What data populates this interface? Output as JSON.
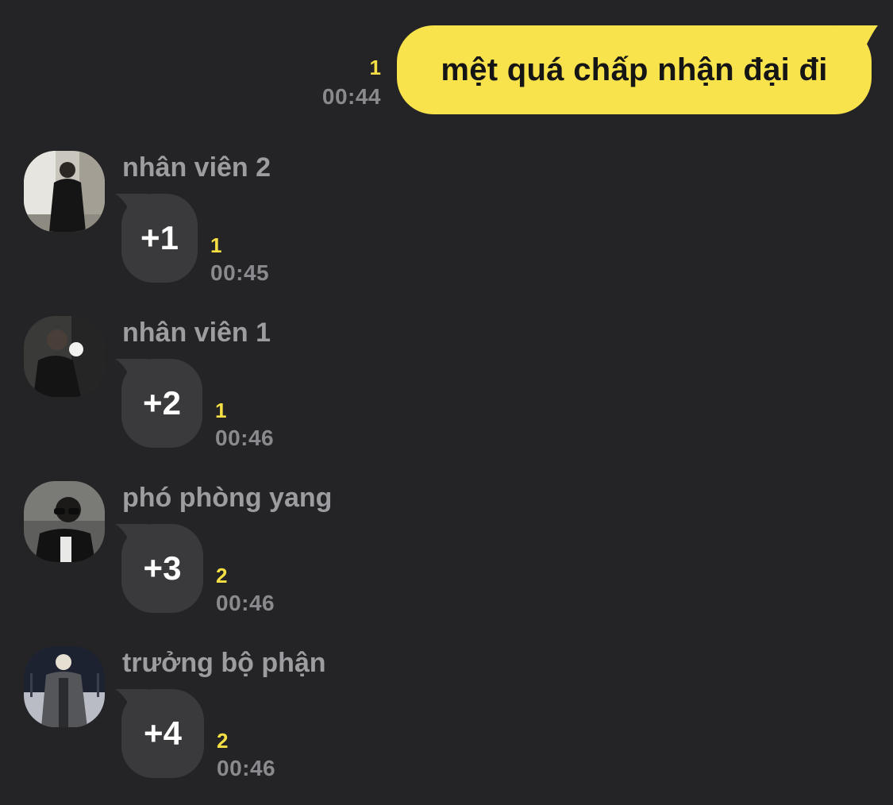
{
  "outgoing": {
    "text": "mệt quá chấp nhận đại đi",
    "unread": "1",
    "time": "00:44"
  },
  "messages": [
    {
      "sender": "nhân viên 2",
      "text": "+1",
      "unread": "1",
      "time": "00:45"
    },
    {
      "sender": "nhân viên 1",
      "text": "+2",
      "unread": "1",
      "time": "00:46"
    },
    {
      "sender": "phó phòng yang",
      "text": "+3",
      "unread": "2",
      "time": "00:46"
    },
    {
      "sender": "trưởng bộ phận",
      "text": "+4",
      "unread": "2",
      "time": "00:46"
    }
  ],
  "colors": {
    "background": "#242426",
    "outgoing_bubble": "#f8e34c",
    "incoming_bubble": "#3a3a3c",
    "unread_count": "#f5df45",
    "timestamp": "#8a8a8e",
    "sender_name": "#9d9da1"
  }
}
